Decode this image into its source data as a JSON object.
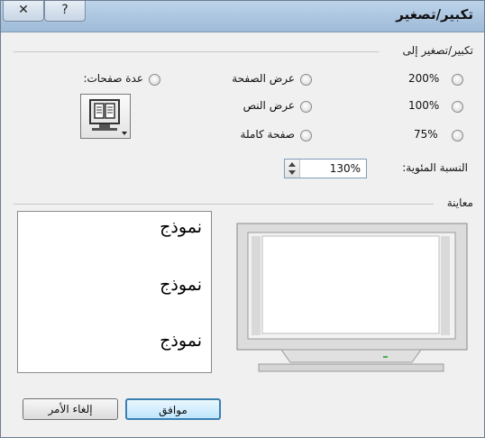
{
  "window": {
    "title": "تكبير/تصغير",
    "close_glyph": "✕",
    "help_glyph": "?"
  },
  "zoom_to": {
    "label": "تكبير/تصغير إلى",
    "options": [
      {
        "label": "200%",
        "selected": false
      },
      {
        "label": "100%",
        "selected": false
      },
      {
        "label": "75%",
        "selected": false
      }
    ],
    "width_options": [
      {
        "label": "عرض الصفحة",
        "selected": false
      },
      {
        "label": "عرض النص",
        "selected": false
      },
      {
        "label": "صفحة كاملة",
        "selected": false
      }
    ],
    "many_pages": {
      "label": "عدة صفحات:",
      "selected": false
    },
    "percent": {
      "label": "النسبة المئوية:",
      "value": "130%"
    }
  },
  "preview": {
    "label": "معاينة",
    "samples": [
      "نموذج",
      "نموذج",
      "نموذج"
    ]
  },
  "buttons": {
    "ok": "موافق",
    "cancel": "إلغاء الأمر"
  },
  "colors": {
    "accent": "#3c7fb1",
    "titlebar": "#9fbbd8"
  }
}
